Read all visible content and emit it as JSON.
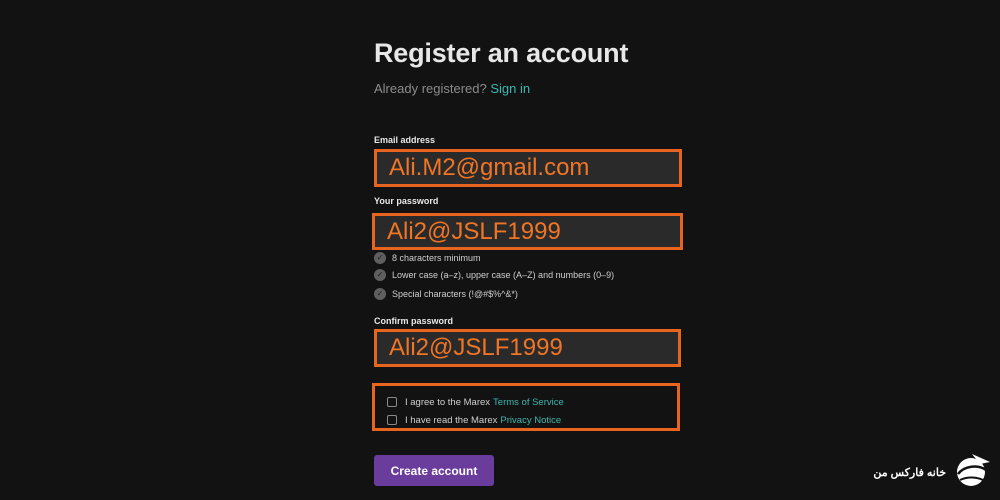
{
  "header": {
    "title": "Register an account",
    "subtitle_prefix": "Already registered?",
    "sign_in_link": "Sign in"
  },
  "form": {
    "email": {
      "label": "Email address",
      "value": "Ali.M2@gmail.com"
    },
    "password": {
      "label": "Your password",
      "value": "Ali2@JSLF1999",
      "rules": [
        "8 characters minimum",
        "Lower case (a–z), upper case (A–Z) and numbers (0–9)",
        "Special characters (!@#$%^&*)"
      ]
    },
    "confirm": {
      "label": "Confirm password",
      "value": "Ali2@JSLF1999"
    },
    "agreements": [
      {
        "text": "I agree to the Marex",
        "link": "Terms of Service",
        "checked": false
      },
      {
        "text": "I have read the Marex",
        "link": "Privacy Notice",
        "checked": false
      }
    ],
    "submit_label": "Create account"
  },
  "watermark": {
    "text": "خانه فارکس من"
  },
  "colors": {
    "background": "#121212",
    "field_background": "#2a2a2a",
    "highlight": "#e8651f",
    "link": "#3fb6b0",
    "button": "#6a3c9c"
  },
  "icons": {
    "rule_check": "check-circle-icon",
    "logo": "globe-plane-icon"
  }
}
